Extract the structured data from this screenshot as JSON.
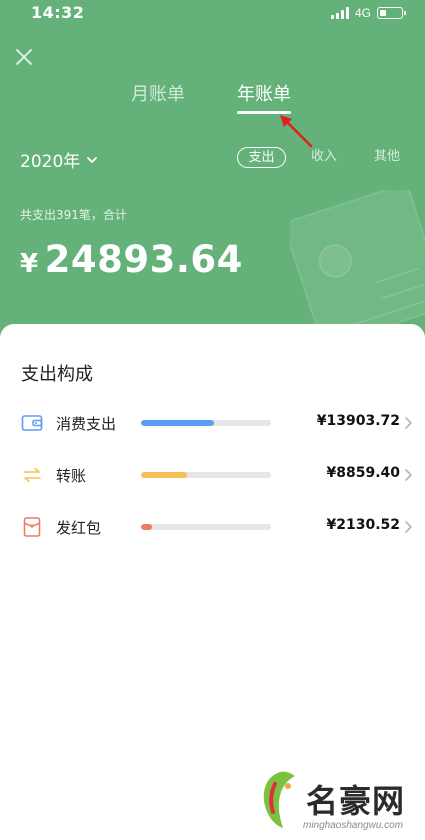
{
  "status_bar": {
    "time": "14:32",
    "network": "4G"
  },
  "tabs": {
    "monthly": "月账单",
    "yearly": "年账单"
  },
  "year": "2020年",
  "type_filters": {
    "expense": "支出",
    "income": "收入",
    "other": "其他"
  },
  "summary": {
    "text": "共支出391笔，合计",
    "currency": "¥",
    "total": "24893.64"
  },
  "breakdown": {
    "title": "支出构成",
    "items": [
      {
        "label": "消费支出",
        "amount": "¥13903.72",
        "share": 0.5585,
        "color": "#5d9cf5",
        "icon": "wallet-icon"
      },
      {
        "label": "转账",
        "amount": "¥8859.40",
        "share": 0.3559,
        "color": "#f5c055",
        "icon": "transfer-icon"
      },
      {
        "label": "发红包",
        "amount": "¥2130.52",
        "share": 0.0856,
        "color": "#ef7b66",
        "icon": "red-packet-icon"
      }
    ]
  },
  "watermark": {
    "logo_text": "名豪网",
    "site": "minghaoshangwu.com"
  },
  "colors": {
    "header": "#64b27a",
    "accent": "#ffffff"
  }
}
